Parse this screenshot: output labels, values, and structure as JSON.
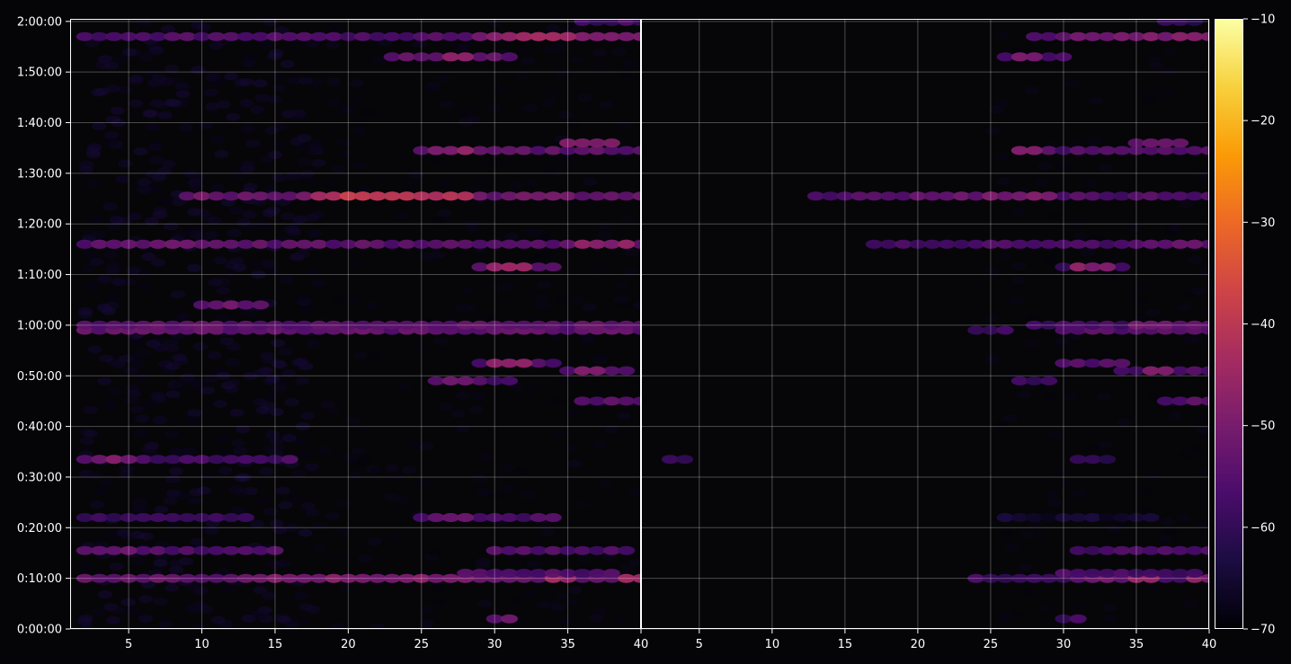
{
  "chart_data": {
    "type": "heatmap",
    "title": "",
    "xlabel": "",
    "ylabel": "",
    "grid": true,
    "panels": [
      {
        "name": "left",
        "xlim": [
          1,
          40
        ],
        "ylim_seconds": [
          0,
          7230
        ],
        "x_tick_labels": [
          "5",
          "10",
          "15",
          "20",
          "25",
          "30",
          "35",
          "40"
        ],
        "x_tick_values": [
          5,
          10,
          15,
          20,
          25,
          30,
          35,
          40
        ],
        "y_tick_labels": [
          "0:00:00",
          "0:10:00",
          "0:20:00",
          "0:30:00",
          "0:40:00",
          "0:50:00",
          "1:00:00",
          "1:10:00",
          "1:20:00",
          "1:30:00",
          "1:40:00",
          "1:50:00",
          "2:00:00"
        ],
        "y_tick_values": [
          0,
          600,
          1200,
          1800,
          2400,
          3000,
          3600,
          4200,
          4800,
          5400,
          6000,
          6600,
          7200
        ]
      },
      {
        "name": "right",
        "xlim": [
          1,
          40
        ],
        "ylim_seconds": [
          0,
          7230
        ],
        "x_tick_labels": [
          "5",
          "10",
          "15",
          "20",
          "25",
          "30",
          "35",
          "40"
        ],
        "x_tick_values": [
          5,
          10,
          15,
          20,
          25,
          30,
          35,
          40
        ]
      }
    ],
    "rows": [
      {
        "time": "0:02:00",
        "t": 120,
        "left": [
          [
            30,
            31,
            -52
          ]
        ],
        "right": [
          [
            30,
            31,
            -58
          ]
        ]
      },
      {
        "time": "0:10:00",
        "t": 600,
        "left": [
          [
            2,
            40,
            -53
          ],
          [
            15,
            28,
            -50
          ],
          [
            34,
            35,
            -44
          ],
          [
            39,
            40,
            -45
          ]
        ],
        "right": [
          [
            24,
            40,
            -58
          ],
          [
            31,
            36,
            -52
          ],
          [
            35,
            36,
            -45
          ],
          [
            39,
            40,
            -48
          ]
        ]
      },
      {
        "time": "0:11:00",
        "t": 660,
        "left": [
          [
            28,
            38,
            -56
          ]
        ],
        "right": [
          [
            30,
            39,
            -57
          ]
        ]
      },
      {
        "time": "0:15:30",
        "t": 930,
        "left": [
          [
            2,
            15,
            -56
          ],
          [
            30,
            39,
            -56
          ],
          [
            3,
            5,
            -52
          ]
        ],
        "right": [
          [
            31,
            40,
            -57
          ]
        ]
      },
      {
        "time": "0:22:00",
        "t": 1320,
        "left": [
          [
            2,
            13,
            -60
          ],
          [
            25,
            34,
            -56
          ],
          [
            26,
            28,
            -53
          ]
        ],
        "right": [
          [
            26,
            36,
            -65
          ]
        ]
      },
      {
        "time": "0:33:30",
        "t": 2010,
        "left": [
          [
            2,
            16,
            -57
          ],
          [
            3,
            5,
            -50
          ]
        ],
        "right": [
          [
            3,
            4,
            -60
          ],
          [
            31,
            33,
            -60
          ]
        ]
      },
      {
        "time": "0:45:00",
        "t": 2700,
        "left": [
          [
            36,
            40,
            -55
          ]
        ],
        "right": [
          [
            37,
            40,
            -55
          ]
        ]
      },
      {
        "time": "0:49:00",
        "t": 2940,
        "left": [
          [
            26,
            31,
            -56
          ],
          [
            27,
            28,
            -50
          ]
        ],
        "right": [
          [
            27,
            29,
            -58
          ]
        ]
      },
      {
        "time": "0:51:00",
        "t": 3060,
        "left": [
          [
            35,
            39,
            -54
          ],
          [
            36,
            37,
            -48
          ]
        ],
        "right": [
          [
            34,
            40,
            -56
          ],
          [
            36,
            37,
            -50
          ]
        ]
      },
      {
        "time": "0:52:30",
        "t": 3150,
        "left": [
          [
            29,
            34,
            -55
          ],
          [
            30,
            32,
            -48
          ]
        ],
        "right": [
          [
            30,
            34,
            -56
          ]
        ]
      },
      {
        "time": "0:59:00",
        "t": 3540,
        "left": [
          [
            2,
            40,
            -53
          ],
          [
            7,
            40,
            -54
          ]
        ],
        "right": [
          [
            24,
            26,
            -58
          ],
          [
            30,
            40,
            -54
          ]
        ]
      },
      {
        "time": "1:00:00",
        "t": 3600,
        "left": [
          [
            2,
            40,
            -54
          ]
        ],
        "right": [
          [
            28,
            40,
            -57
          ],
          [
            35,
            40,
            -52
          ]
        ]
      },
      {
        "time": "1:04:00",
        "t": 3840,
        "left": [
          [
            10,
            14,
            -55
          ],
          [
            11,
            13,
            -52
          ]
        ],
        "right": []
      },
      {
        "time": "1:11:30",
        "t": 4290,
        "left": [
          [
            29,
            34,
            -55
          ],
          [
            30,
            32,
            -46
          ]
        ],
        "right": [
          [
            30,
            34,
            -58
          ],
          [
            31,
            33,
            -48
          ]
        ]
      },
      {
        "time": "1:16:00",
        "t": 4560,
        "left": [
          [
            2,
            40,
            -54
          ],
          [
            3,
            5,
            -53
          ],
          [
            7,
            9,
            -50
          ],
          [
            36,
            39,
            -48
          ]
        ],
        "right": [
          [
            17,
            40,
            -57
          ],
          [
            35,
            39,
            -53
          ]
        ]
      },
      {
        "time": "1:25:30",
        "t": 5130,
        "left": [
          [
            9,
            40,
            -52
          ],
          [
            18,
            28,
            -42
          ],
          [
            20,
            22,
            -38
          ]
        ],
        "right": [
          [
            13,
            40,
            -56
          ],
          [
            20,
            28,
            -52
          ],
          [
            25,
            29,
            -50
          ]
        ]
      },
      {
        "time": "1:34:30",
        "t": 5670,
        "left": [
          [
            25,
            40,
            -54
          ],
          [
            26,
            28,
            -48
          ]
        ],
        "right": [
          [
            27,
            40,
            -56
          ],
          [
            27,
            28,
            -50
          ]
        ]
      },
      {
        "time": "1:36:00",
        "t": 5760,
        "left": [
          [
            35,
            38,
            -50
          ]
        ],
        "right": [
          [
            35,
            38,
            -52
          ]
        ]
      },
      {
        "time": "1:53:00",
        "t": 6780,
        "left": [
          [
            23,
            31,
            -54
          ],
          [
            27,
            28,
            -48
          ]
        ],
        "right": [
          [
            26,
            30,
            -56
          ],
          [
            27,
            28,
            -50
          ]
        ]
      },
      {
        "time": "1:57:00",
        "t": 7020,
        "left": [
          [
            2,
            40,
            -56
          ],
          [
            29,
            40,
            -49
          ],
          [
            31,
            35,
            -45
          ]
        ],
        "right": [
          [
            28,
            40,
            -55
          ],
          [
            31,
            40,
            -50
          ]
        ]
      },
      {
        "time": "2:00:00",
        "t": 7200,
        "left": [
          [
            36,
            40,
            -58
          ]
        ],
        "right": [
          [
            37,
            39,
            -60
          ]
        ]
      }
    ]
  },
  "colorbar": {
    "vmin": -70,
    "vmax": -10,
    "colormap": "inferno",
    "tick_values": [
      -70,
      -60,
      -50,
      -40,
      -30,
      -20,
      -10
    ],
    "tick_labels": [
      "−70",
      "−60",
      "−50",
      "−40",
      "−30",
      "−20",
      "−10"
    ],
    "colors": [
      "#000004",
      "#1b0c41",
      "#4a0c6b",
      "#781c6d",
      "#a52c60",
      "#cf4446",
      "#ed6925",
      "#fb9b06",
      "#f7d13d",
      "#fcffa4"
    ]
  },
  "style": {
    "background": "#050507",
    "plot_background": "#060608",
    "grid_color": "#ffffff",
    "frame_color": "#ffffff",
    "text_color": "#ffffff"
  }
}
